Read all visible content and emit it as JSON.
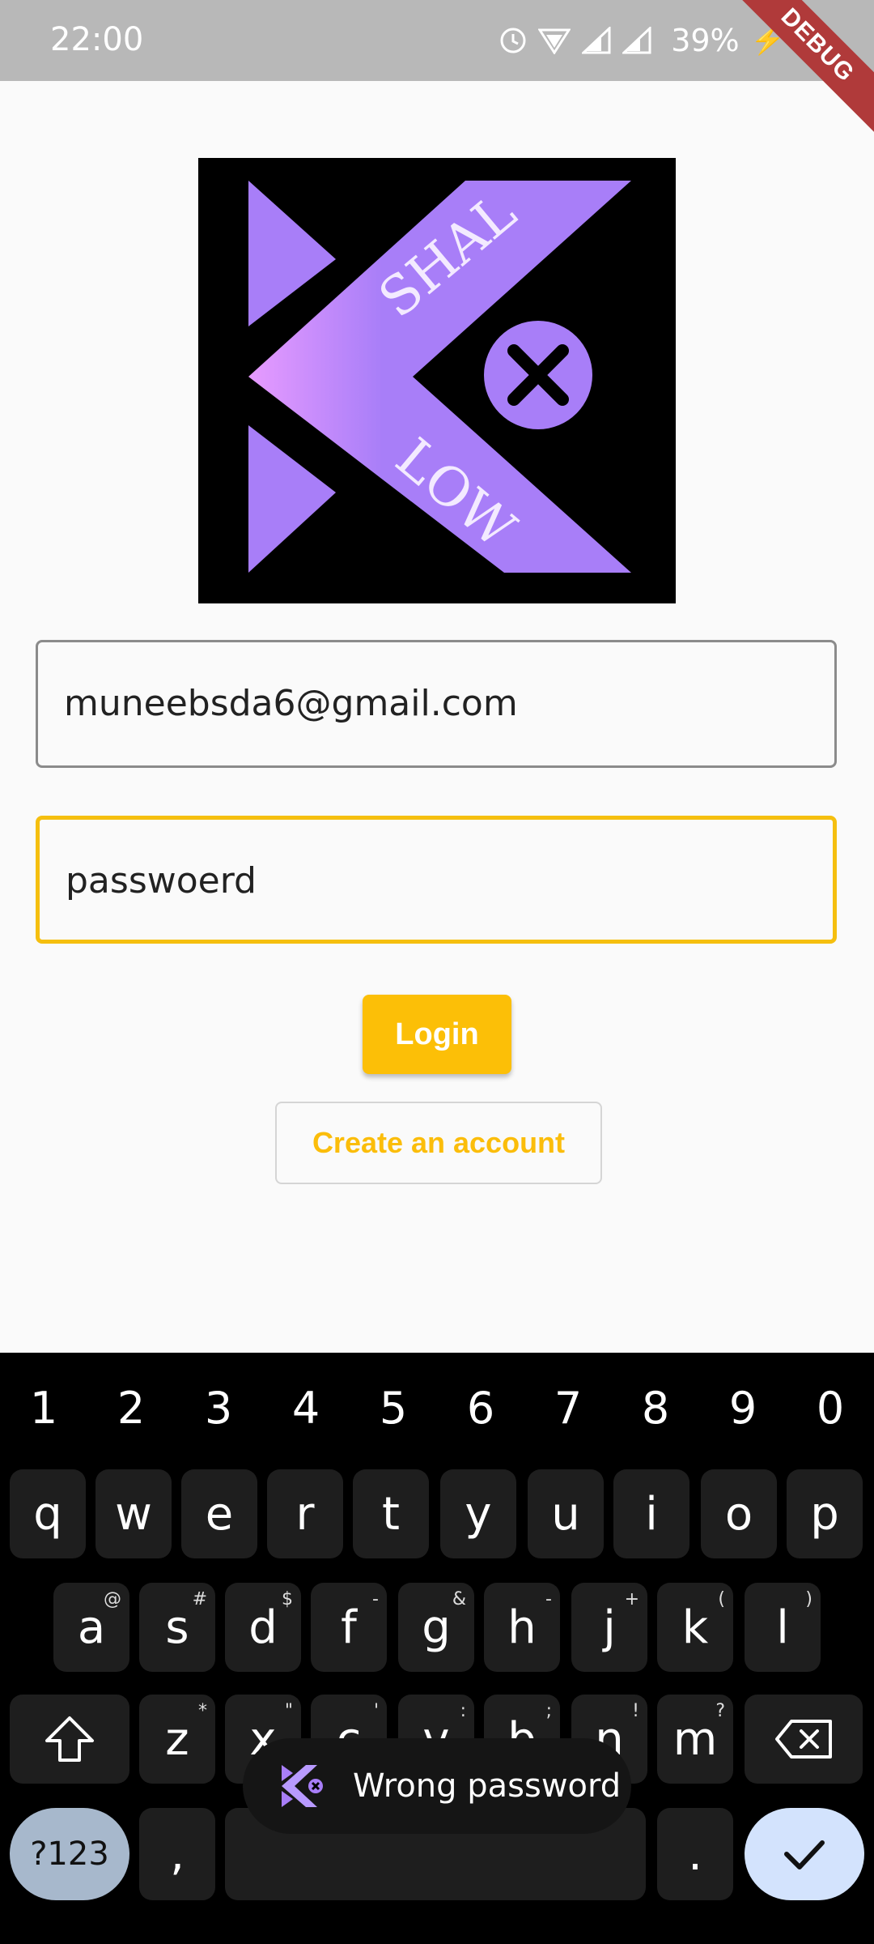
{
  "status_bar": {
    "time": "22:00",
    "battery": "39%",
    "debug_banner": "DEBUG"
  },
  "logo": {
    "text_top": "SHAL",
    "text_bottom": "LOW"
  },
  "form": {
    "email_value": "muneebsda6@gmail.com",
    "password_value": "passwoerd",
    "login_label": "Login",
    "create_account_label": "Create an account",
    "accent_color": "#FCBF07"
  },
  "keyboard": {
    "number_row": [
      "1",
      "2",
      "3",
      "4",
      "5",
      "6",
      "7",
      "8",
      "9",
      "0"
    ],
    "row1": [
      "q",
      "w",
      "e",
      "r",
      "t",
      "y",
      "u",
      "i",
      "o",
      "p"
    ],
    "row2": [
      {
        "key": "a",
        "sup": "@"
      },
      {
        "key": "s",
        "sup": "#"
      },
      {
        "key": "d",
        "sup": "$"
      },
      {
        "key": "f",
        "sup": "-"
      },
      {
        "key": "g",
        "sup": "&"
      },
      {
        "key": "h",
        "sup": "-"
      },
      {
        "key": "j",
        "sup": "+"
      },
      {
        "key": "k",
        "sup": "("
      },
      {
        "key": "l",
        "sup": ")"
      }
    ],
    "row3": [
      {
        "key": "z",
        "sup": "*"
      },
      {
        "key": "x",
        "sup": "\""
      },
      {
        "key": "c",
        "sup": "'"
      },
      {
        "key": "v",
        "sup": ":"
      },
      {
        "key": "b",
        "sup": ";"
      },
      {
        "key": "n",
        "sup": "!"
      },
      {
        "key": "m",
        "sup": "?"
      }
    ],
    "symbols_label": "?123",
    "comma_label": ",",
    "period_label": "."
  },
  "toast": {
    "message": "Wrong password"
  }
}
